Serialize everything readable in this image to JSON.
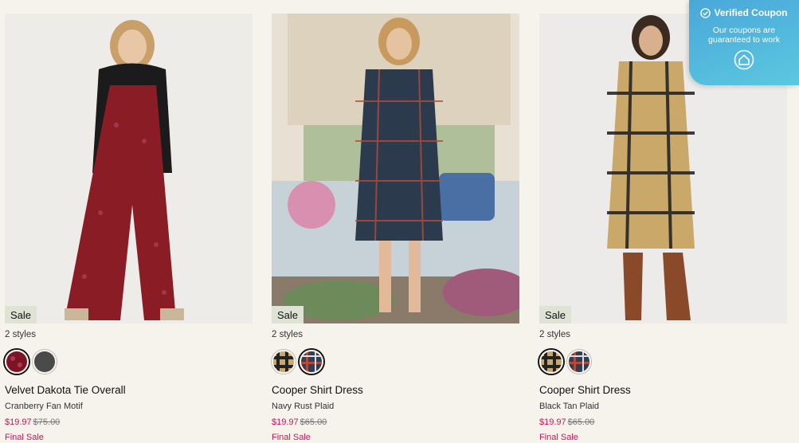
{
  "coupon": {
    "title": "Verified Coupon",
    "text": "Our coupons are guaranteed to work",
    "icon": "check-circle-icon",
    "logo": "house-logo-icon"
  },
  "products": [
    {
      "sale_badge": "Sale",
      "styles_count": "2 styles",
      "name": "Velvet Dakota Tie Overall",
      "color": "Cranberry Fan Motif",
      "price_sale": "$19.97",
      "price_original": "$75.00",
      "final_sale": "Final Sale",
      "swatches": [
        "cranberry",
        "charcoal"
      ]
    },
    {
      "sale_badge": "Sale",
      "styles_count": "2 styles",
      "name": "Cooper Shirt Dress",
      "color": "Navy Rust Plaid",
      "price_sale": "$19.97",
      "price_original": "$65.00",
      "final_sale": "Final Sale",
      "swatches": [
        "black-tan-plaid",
        "navy-rust-plaid"
      ]
    },
    {
      "sale_badge": "Sale",
      "styles_count": "2 styles",
      "name": "Cooper Shirt Dress",
      "color": "Black Tan Plaid",
      "price_sale": "$19.97",
      "price_original": "$65.00",
      "final_sale": "Final Sale",
      "swatches": [
        "black-tan-plaid",
        "navy-rust-plaid"
      ]
    }
  ],
  "colors": {
    "sale_price": "#c2185b",
    "badge_bg": "#dfe3d6",
    "coupon_bg": "#4aa7d9",
    "page_bg": "#f6f3ec"
  }
}
